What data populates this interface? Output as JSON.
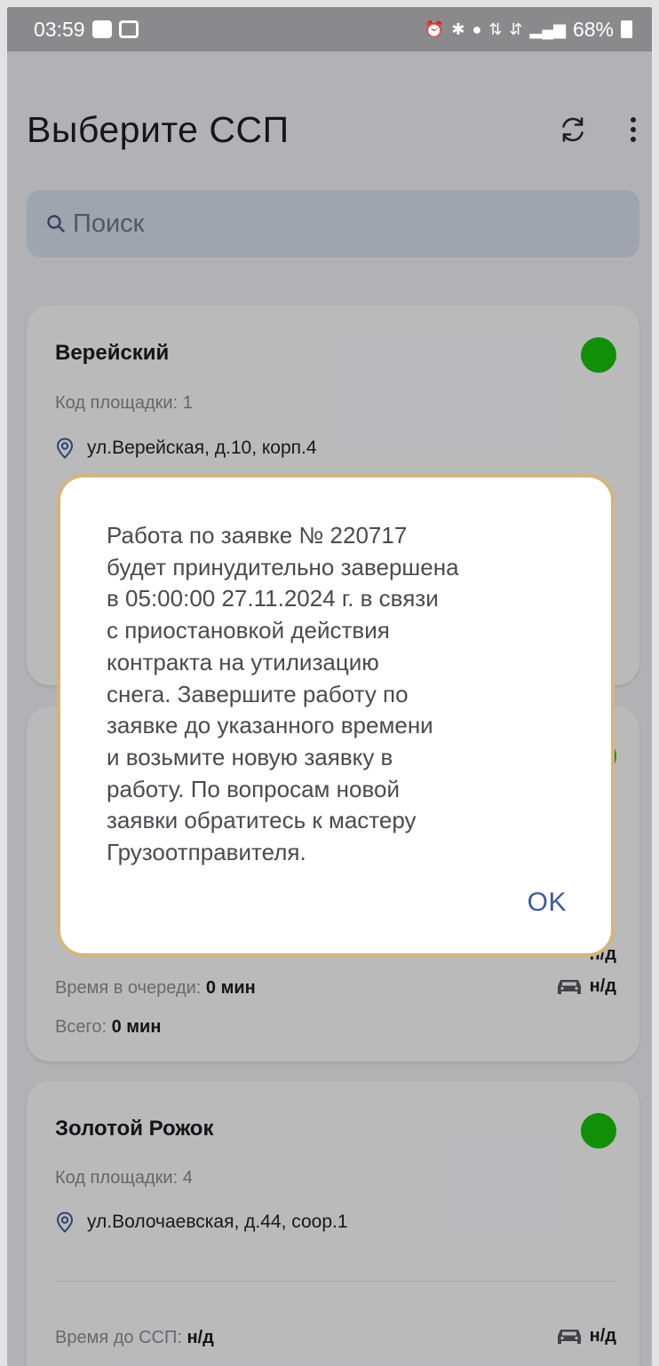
{
  "status_bar": {
    "time": "03:59",
    "battery": "68%"
  },
  "header": {
    "title": "Выберите ССП"
  },
  "search": {
    "placeholder": "Поиск"
  },
  "cards": [
    {
      "name": "Верейский",
      "code": "Код площадки: 1",
      "address": "ул.Верейская, д.10, корп.4",
      "status_color": "#17c20d"
    },
    {
      "time_in_queue_label": "Время в очереди: ",
      "time_in_queue_value": "0 мин",
      "vehicle_value": "н/д",
      "total_label": "Всего: ",
      "total_value": "0 мин",
      "partial_value": "н/д",
      "status_color": "#17c20d"
    },
    {
      "name": "Золотой Рожок",
      "code": "Код площадки: 4",
      "address": "ул.Волочаевская, д.44, соор.1",
      "time_to_ssp_label": "Время до ССП: ",
      "time_to_ssp_value": "н/д",
      "vehicle_value": "н/д",
      "status_color": "#17c20d"
    }
  ],
  "dialog": {
    "message": "Работа по заявке № 220717\nбудет принудительно завершена\nв 05:00:00 27.11.2024 г. в связи\nс приостановкой действия\nконтракта на утилизацию\nснега. Завершите работу по\nзаявке до указанного времени\nи возьмите новую заявку в\nработу. По вопросам новой\nзаявки обратитесь к мастеру\nГрузоотправителя.",
    "ok_label": "OK"
  }
}
